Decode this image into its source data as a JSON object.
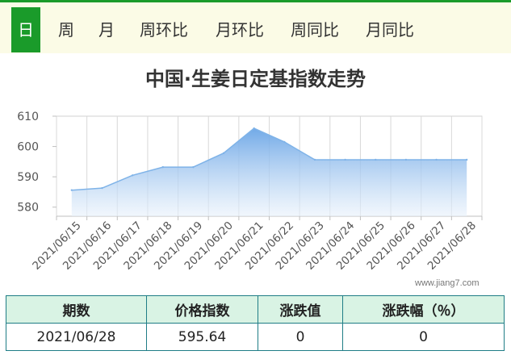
{
  "tabs": [
    {
      "label": "日",
      "active": true
    },
    {
      "label": "周",
      "active": false
    },
    {
      "label": "月",
      "active": false
    },
    {
      "label": "周环比",
      "active": false
    },
    {
      "label": "月环比",
      "active": false
    },
    {
      "label": "周同比",
      "active": false
    },
    {
      "label": "月同比",
      "active": false
    }
  ],
  "colors": {
    "accent": "#1a9b2a",
    "tab_bg": "#fbfbe6",
    "line": "#7fb3e8",
    "table_border": "#1f7d86",
    "table_header_bg": "#d9f3e4"
  },
  "chart_data": {
    "type": "area",
    "title": "中国·生姜日定基指数走势",
    "xlabel": "",
    "ylabel": "",
    "x": [
      "2021/06/15",
      "2021/06/16",
      "2021/06/17",
      "2021/06/18",
      "2021/06/19",
      "2021/06/20",
      "2021/06/21",
      "2021/06/22",
      "2021/06/23",
      "2021/06/24",
      "2021/06/25",
      "2021/06/26",
      "2021/06/27",
      "2021/06/28"
    ],
    "series": [
      {
        "values": [
          585.6,
          586.3,
          590.5,
          593.2,
          593.2,
          597.8,
          606.0,
          601.5,
          595.64,
          595.64,
          595.64,
          595.64,
          595.64,
          595.64
        ]
      }
    ],
    "ylim": [
      577,
      610
    ],
    "yticks": [
      580,
      590,
      600,
      610
    ],
    "grid": true,
    "legend": "none"
  },
  "watermark": "www.jiang7.com",
  "summary": {
    "headers": [
      "期数",
      "价格指数",
      "涨跌值",
      "涨跌幅（％）"
    ],
    "row": [
      "2021/06/28",
      "595.64",
      "0",
      "0"
    ]
  }
}
